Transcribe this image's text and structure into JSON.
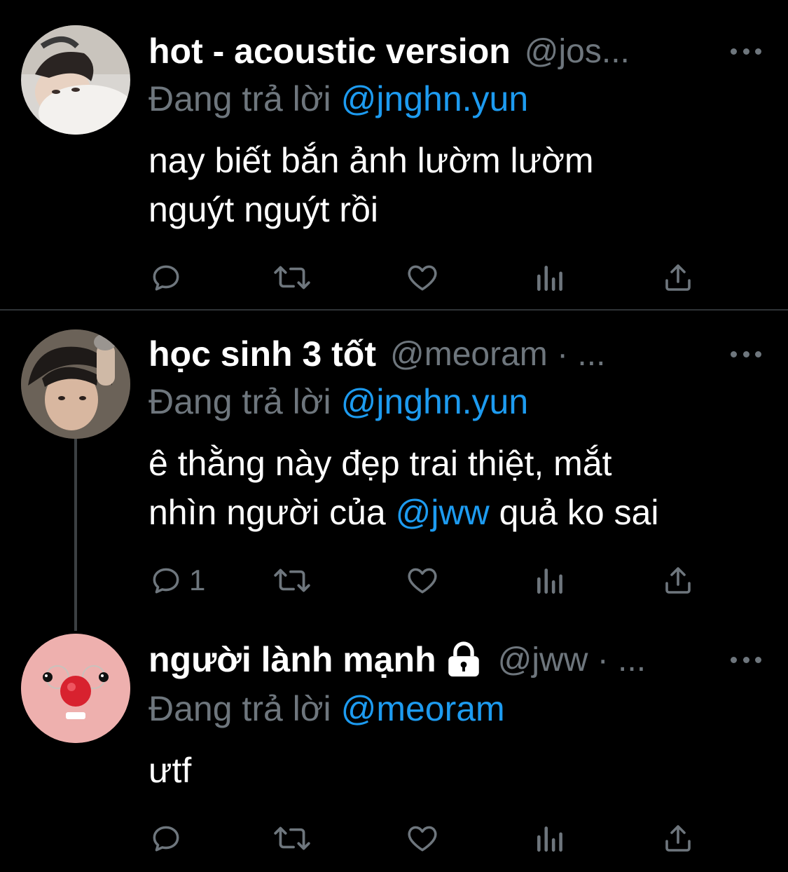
{
  "tweets": [
    {
      "display_name": "hot - acoustic version",
      "handle": "@jos...",
      "replying_prefix": "Đang trả lời ",
      "replying_to": "@jnghn.yun",
      "text_line1": "nay biết bắn ảnh lườm lườm",
      "text_line2": "nguýt nguýt rồi",
      "reply_count": ""
    },
    {
      "display_name": "học sinh 3 tốt",
      "handle": "@meoram · ...",
      "replying_prefix": "Đang trả lời ",
      "replying_to": "@jnghn.yun",
      "text_line1": "ê thằng này đẹp trai thiệt, mắt",
      "text_line2_before": "nhìn người của ",
      "text_line2_mention": "@jww",
      "text_line2_after": " quả ko sai",
      "reply_count": "1"
    },
    {
      "display_name": "người lành mạnh",
      "handle": "@jww · ...",
      "replying_prefix": "Đang trả lời ",
      "replying_to": "@meoram",
      "text_line1": "ưtf",
      "reply_count": ""
    }
  ],
  "icons": {
    "reply": "reply-icon",
    "retweet": "retweet-icon",
    "like": "heart-icon",
    "views": "views-icon",
    "share": "share-icon",
    "more": "more-icon",
    "lock": "lock-icon"
  },
  "colors": {
    "background": "#000000",
    "text": "#ffffff",
    "muted": "#6e767d",
    "mention": "#1d9bf0",
    "divider": "#2f3336"
  }
}
